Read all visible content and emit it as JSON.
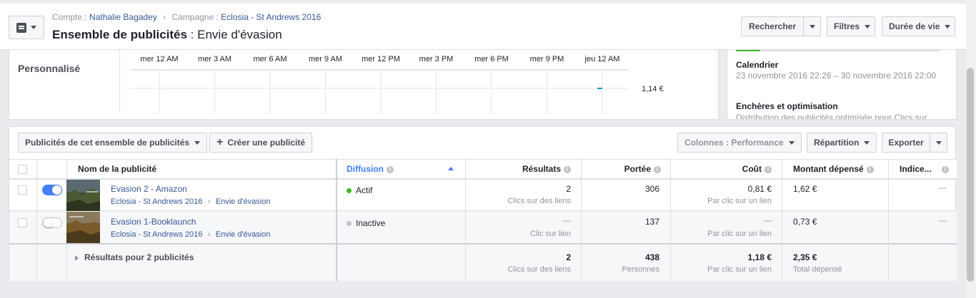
{
  "header": {
    "account_label": "Compte :",
    "account_name": "Nathalie Bagadey",
    "campaign_label": "Campagne :",
    "campaign_name": "Eclosia - St Andrews 2016",
    "entity_type": "Ensemble de publicités",
    "entity_sep": " : ",
    "entity_name": "Envie d'évasion",
    "buttons": {
      "search": "Rechercher",
      "filters": "Filtres",
      "lifetime": "Durée de vie"
    }
  },
  "chart": {
    "title": "Personnalisé",
    "time_labels": [
      "mer 12 AM",
      "mer 3 AM",
      "mer 6 AM",
      "mer 9 AM",
      "mer 12 PM",
      "mer 3 PM",
      "mer 6 PM",
      "mer 9 PM",
      "jeu 12 AM"
    ],
    "y_label": "1,14 €",
    "line_color": "#00a0b0"
  },
  "info_panel": {
    "progress": 0.12,
    "calendar_heading": "Calendrier",
    "calendar_range": "23 novembre 2016 22:26 – 30 novembre 2016 22:00",
    "bidding_heading": "Enchères et optimisation",
    "bidding_text": "Distribution des publicités optimisée pour Clics sur"
  },
  "toolbar": {
    "ads_dropdown": "Publicités de cet ensemble de publicités",
    "create_ad": "Créer une publicité",
    "columns": "Colonnes : Performance",
    "breakdown": "Répartition",
    "export": "Exporter"
  },
  "table": {
    "headers": {
      "name": "Nom de la publicité",
      "delivery": "Diffusion",
      "results": "Résultats",
      "reach": "Portée",
      "cost": "Coût",
      "spent": "Montant dépensé",
      "index": "Indice..."
    },
    "rows": [
      {
        "name": "Evasion 2 - Amazon",
        "campaign": "Eclosia - St Andrews 2016",
        "adset": "Envie d'évasion",
        "active": true,
        "status": "Actif",
        "status_color": "#42b72a",
        "results": "2",
        "results_sub": "Clics sur des liens",
        "reach": "306",
        "cost": "0,81 €",
        "cost_sub": "Par clic sur un lien",
        "spent": "1,62 €",
        "index": "—"
      },
      {
        "name": "Evasion 1-Booklaunch",
        "campaign": "Eclosia - St Andrews 2016",
        "adset": "Envie d'évasion",
        "active": false,
        "status": "Inactive",
        "status_color": "#bec2c9",
        "results": "—",
        "results_sub": "Clic sur lien",
        "reach": "137",
        "cost": "—",
        "cost_sub": "Par clic sur un lien",
        "spent": "0,73 €",
        "index": "—"
      }
    ],
    "totals": {
      "label": "Résultats pour 2 publicités",
      "results": "2",
      "results_sub": "Clics sur des liens",
      "reach": "438",
      "reach_sub": "Personnes",
      "cost": "1,18 €",
      "cost_sub": "Par clic sur un lien",
      "spent": "2,35 €",
      "spent_sub": "Total dépensé"
    }
  }
}
